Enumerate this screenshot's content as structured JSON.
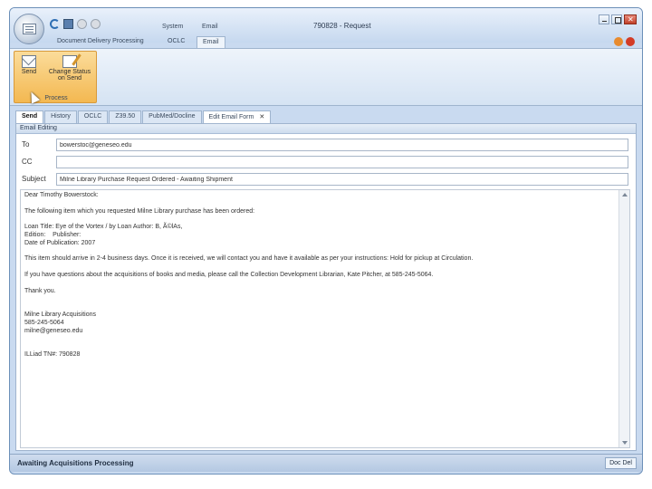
{
  "window": {
    "title": "790828 - Request",
    "context_tabs": [
      "System",
      "Email"
    ]
  },
  "ribbon": {
    "tabs": [
      "Document Delivery Processing",
      "OCLC",
      "Email"
    ],
    "group_label": "Process",
    "buttons": {
      "send": "Send",
      "change_status": "Change Status on Send"
    }
  },
  "doc_tabs": [
    "Send",
    "History",
    "OCLC",
    "Z39.50",
    "PubMed/Docline",
    "Edit Email Form"
  ],
  "email": {
    "section_label": "Email Editing",
    "to_label": "To",
    "to_value": "bowerstoc@geneseo.edu",
    "cc_label": "CC",
    "cc_value": "",
    "subject_label": "Subject",
    "subject_value": "Milne Library Purchase Request Ordered - Awaiting Shipment",
    "body_lines": [
      "Dear Timothy Bowerstock:",
      "",
      "The following item which you requested Milne Library purchase has been ordered:",
      "",
      "Loan Title: Eye of the Vortex / by Loan Author: B, Ã©lAs,",
      "Edition:    Publisher:",
      "Date of Publication: 2007",
      "",
      "This item should arrive in 2-4 business days. Once it is received, we will contact you and have it available as per your instructions: Hold for pickup at Circulation.",
      "",
      "If you have questions about the acquisitions of books and media, please call the Collection Development Librarian, Kate Pitcher, at 585-245-5064.",
      "",
      "Thank you.",
      "",
      "",
      "Milne Library Acquisitions",
      "585-245-5064",
      "milne@geneseo.edu",
      "",
      "",
      "ILLiad TN#: 790828"
    ]
  },
  "status": {
    "text": "Awaiting Acquisitions Processing",
    "button": "Doc Del"
  },
  "icons": [
    "orb-icon",
    "refresh-icon",
    "save-icon",
    "circle-icon",
    "minimize-icon",
    "maximize-icon",
    "close-icon",
    "help-icon",
    "exit-icon",
    "envelope-icon",
    "edit-icon",
    "cursor-icon",
    "scroll-up-icon",
    "scroll-down-icon"
  ]
}
